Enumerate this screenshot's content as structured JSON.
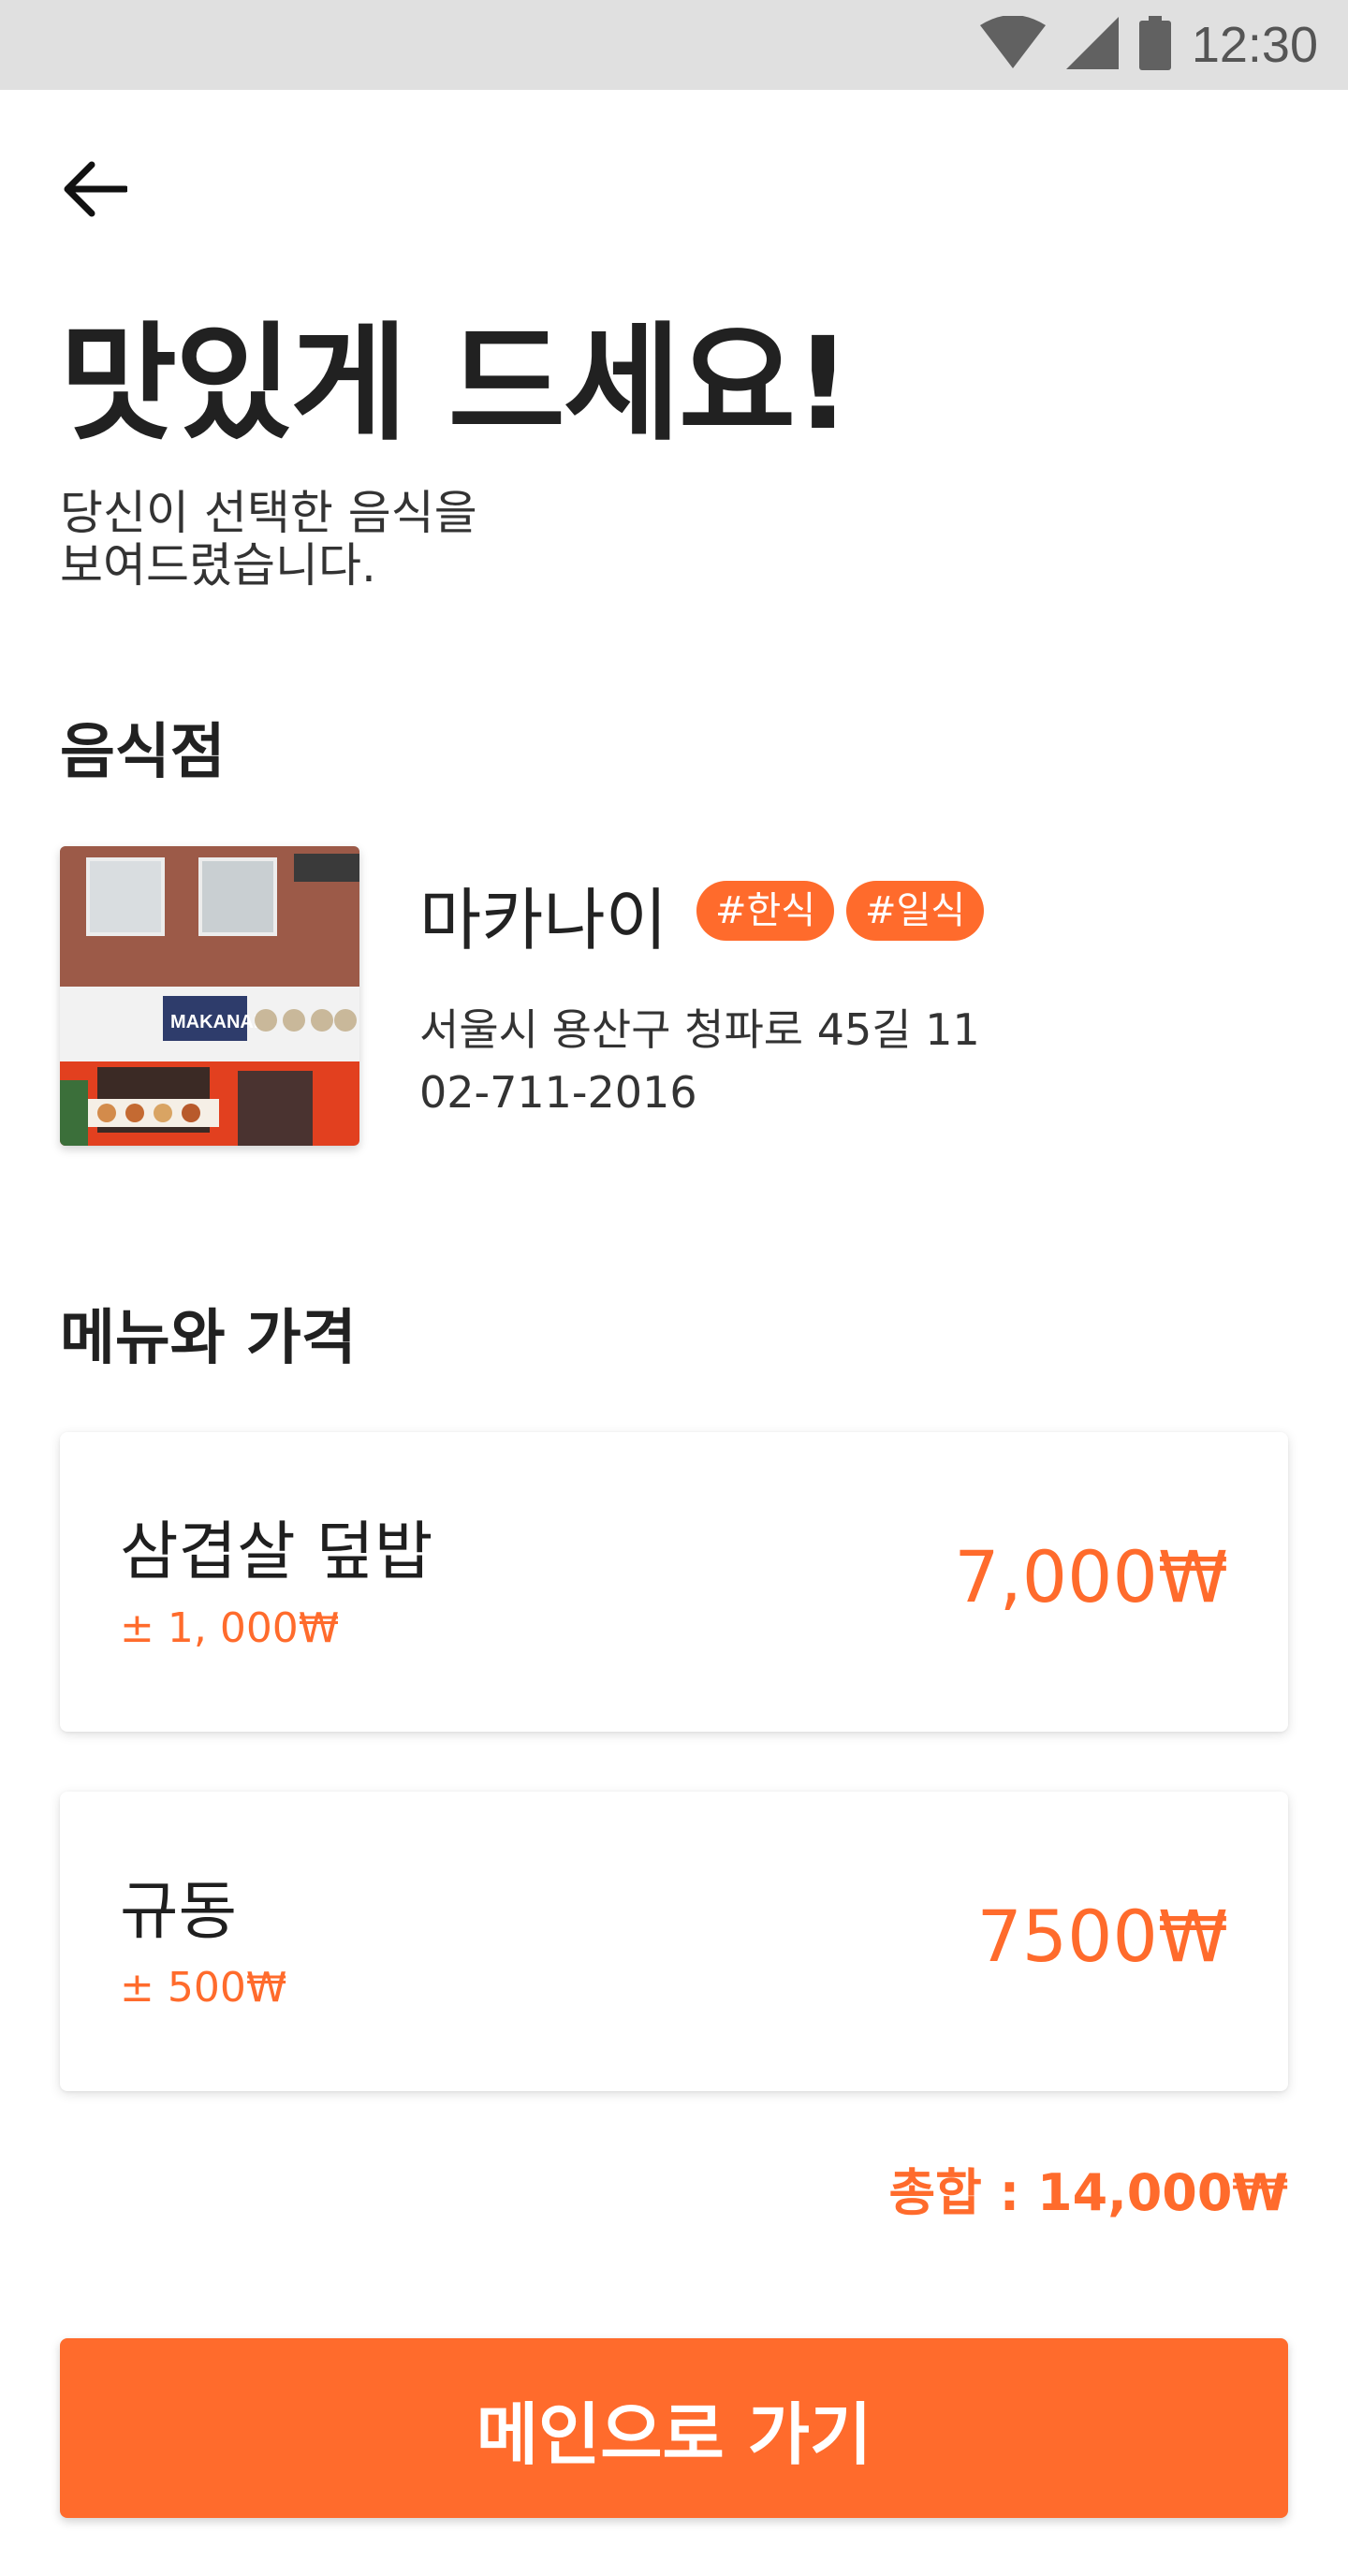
{
  "status_bar": {
    "time": "12:30",
    "icons": [
      "wifi-icon",
      "cell-signal-icon",
      "battery-icon"
    ]
  },
  "header": {
    "back_icon": "arrow-left-icon",
    "title": "맛있게 드세요!",
    "subtitle_line1": "당신이 선택한 음식을",
    "subtitle_line2": "보여드렸습니다."
  },
  "restaurant_section": {
    "heading": "음식점",
    "name": "마카나이",
    "tags": [
      "#한식",
      "#일식"
    ],
    "address": "서울시 용산구 청파로 45길 11",
    "phone": "02-711-2016",
    "photo_sign_text": "MAKANAI"
  },
  "menu_section": {
    "heading": "메뉴와 가격",
    "items": [
      {
        "name": "삼겹살 덮밥",
        "variance": "± 1, 000₩",
        "price": "7,000₩"
      },
      {
        "name": "규동",
        "variance": "± 500₩",
        "price": "7500₩"
      }
    ],
    "total": "총합 : 14,000₩"
  },
  "footer": {
    "main_button_label": "메인으로 가기"
  },
  "colors": {
    "accent": "#ff6b2c",
    "status_bar": "#e0e0e0",
    "text": "#212121"
  }
}
